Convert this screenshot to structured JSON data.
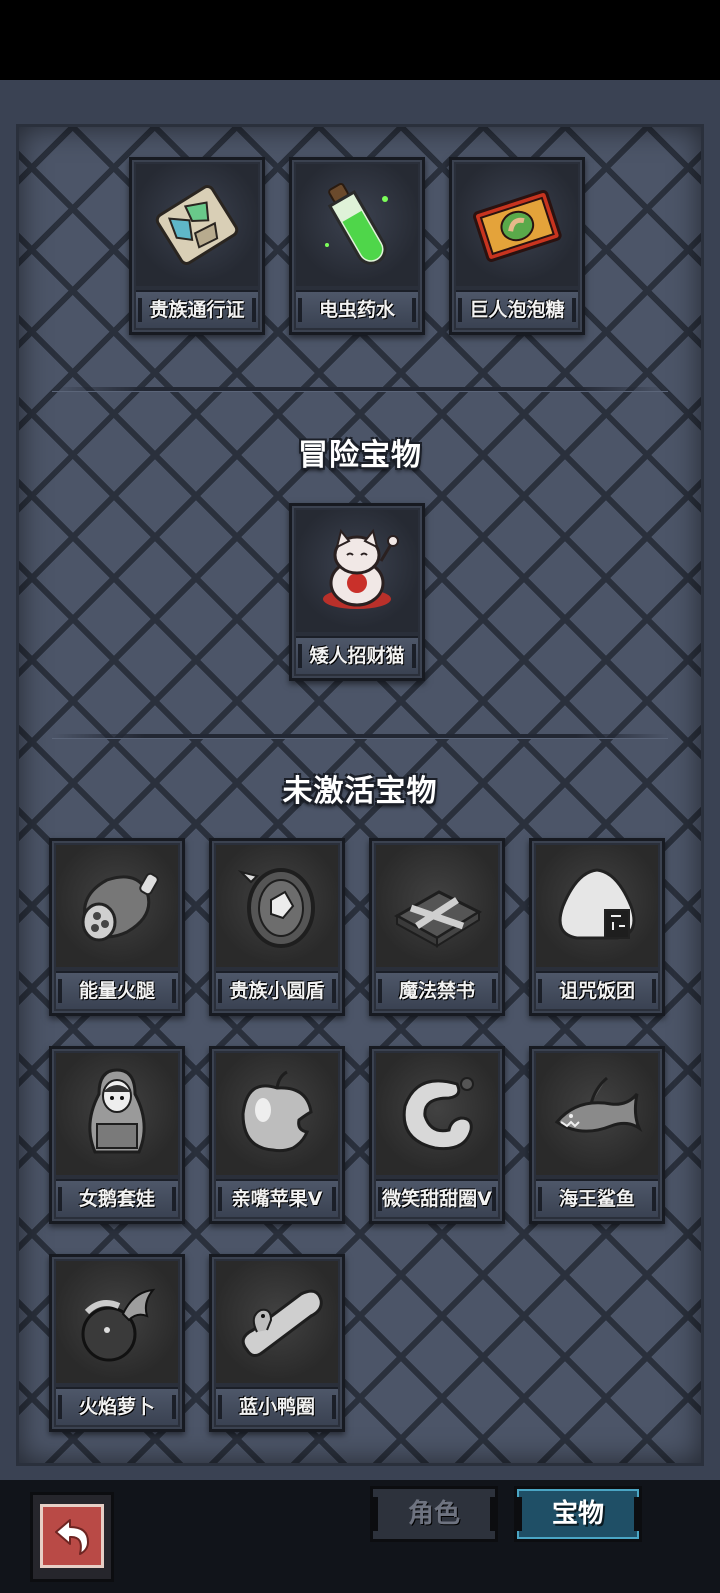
{
  "active_treasures": [
    {
      "name": "贵族通行证",
      "icon": "noble-pass-icon"
    },
    {
      "name": "电虫药水",
      "icon": "electric-potion-icon"
    },
    {
      "name": "巨人泡泡糖",
      "icon": "giant-bubblegum-icon"
    }
  ],
  "adventure_section": {
    "title": "冒险宝物",
    "items": [
      {
        "name": "矮人招财猫",
        "icon": "lucky-cat-icon"
      }
    ]
  },
  "inactive_section": {
    "title": "未激活宝物",
    "items": [
      {
        "name": "能量火腿",
        "icon": "ham-icon"
      },
      {
        "name": "贵族小圆盾",
        "icon": "round-shield-icon"
      },
      {
        "name": "魔法禁书",
        "icon": "forbidden-book-icon"
      },
      {
        "name": "诅咒饭团",
        "icon": "rice-ball-icon"
      },
      {
        "name": "女鹅套娃",
        "icon": "nesting-doll-icon"
      },
      {
        "name": "亲嘴苹果V",
        "icon": "bitten-apple-icon"
      },
      {
        "name": "微笑甜甜圈V",
        "icon": "donut-icon"
      },
      {
        "name": "海王鲨鱼",
        "icon": "shark-icon"
      },
      {
        "name": "火焰萝卜",
        "icon": "fire-radish-icon"
      },
      {
        "name": "蓝小鸭圈",
        "icon": "duck-ring-icon"
      }
    ]
  },
  "bottom_nav": {
    "back_icon": "back-arrow-icon",
    "tabs": [
      {
        "label": "角色",
        "active": false
      },
      {
        "label": "宝物",
        "active": true
      }
    ]
  },
  "colors": {
    "panel": "#4c5568",
    "grid_lines": "#2a303c",
    "active_tab": "#1f4f66",
    "back_button": "#b94a46"
  }
}
